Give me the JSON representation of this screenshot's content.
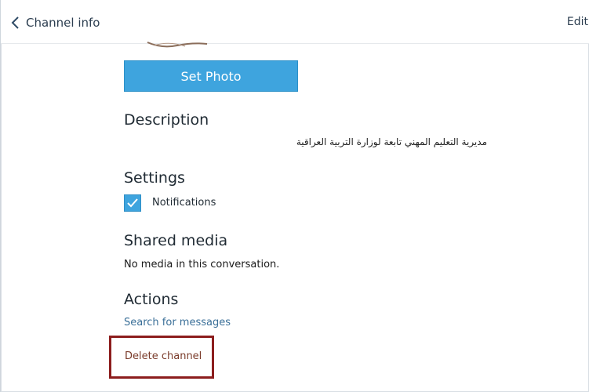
{
  "header": {
    "back_label": "Channel info",
    "edit_label": "Edit"
  },
  "photo": {
    "set_photo_label": "Set Photo"
  },
  "description": {
    "title": "Description",
    "text": "مديرية التعليم المهني تابعة لوزارة التربية العراقية"
  },
  "settings": {
    "title": "Settings",
    "notifications_label": "Notifications",
    "notifications_checked": true
  },
  "shared_media": {
    "title": "Shared media",
    "empty_text": "No media in this conversation."
  },
  "actions": {
    "title": "Actions",
    "search_label": "Search for messages",
    "delete_label": "Delete channel"
  },
  "colors": {
    "accent": "#3ea4de",
    "highlight_box": "#8c1d1d",
    "link": "#3a6f98"
  },
  "icons": {
    "back": "chevron-left-icon",
    "check": "checkmark-icon"
  }
}
